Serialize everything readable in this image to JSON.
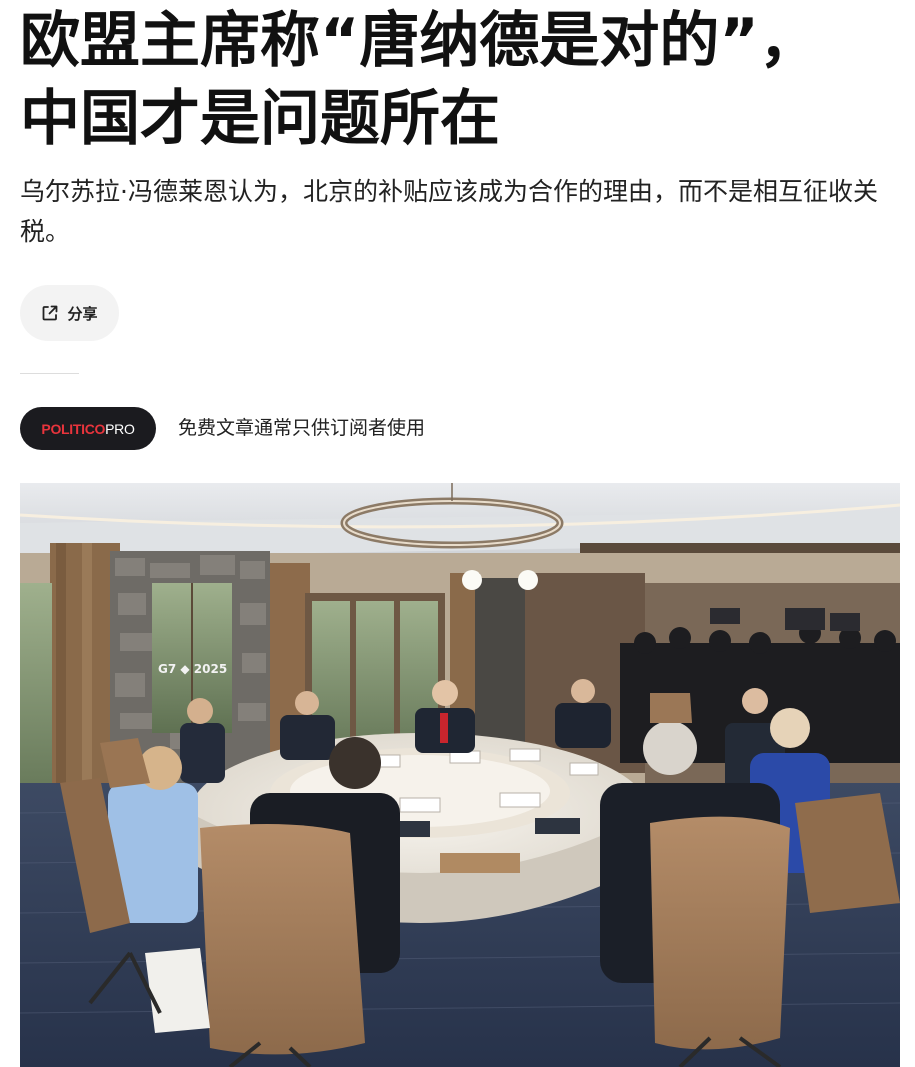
{
  "article": {
    "headline_line1": "欧盟主席称“唐纳德是对的”，",
    "headline_line2": "中国才是问题所在",
    "dek": "乌尔苏拉·冯德莱恩认为，北京的补贴应该成为合作的理由，而不是相互征收关税。",
    "share_label": "分享",
    "share_icon": "external-share-icon",
    "badge": {
      "part1": "POLITICO",
      "part2": "PRO",
      "background": "#1b1b1f",
      "accent": "#e8343c"
    },
    "pro_note": "免费文章通常只供订阅者使用"
  },
  "photo": {
    "wall_sign": "G7 ◆ 2025",
    "description_icon": "photo"
  }
}
